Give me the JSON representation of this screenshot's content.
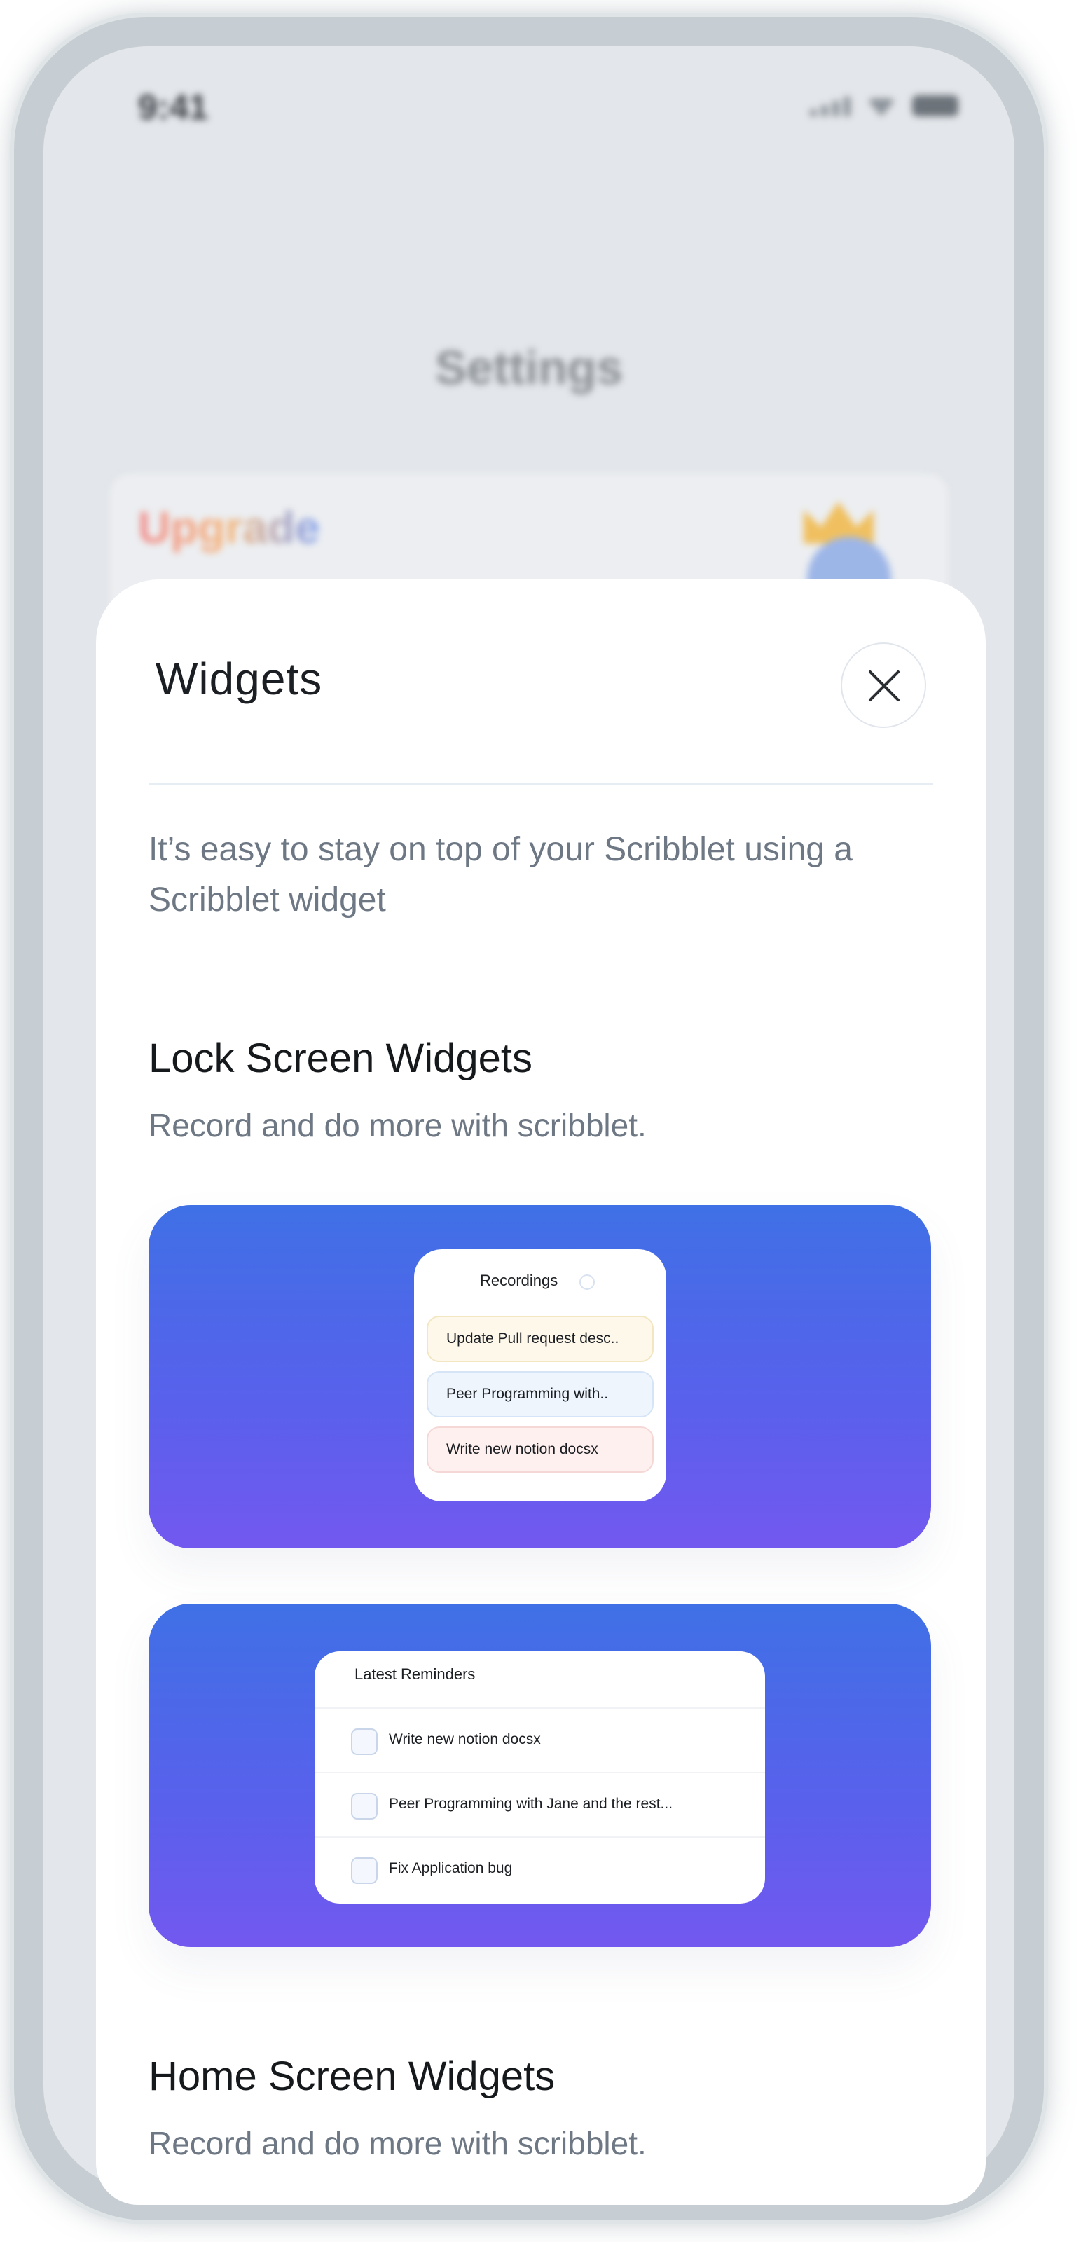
{
  "status_bar": {
    "time": "9:41"
  },
  "background": {
    "title": "Settings",
    "upgrade_label": "Upgrade"
  },
  "sheet": {
    "title": "Widgets",
    "intro": "It’s easy to stay on top of your Scribblet using a Scribblet widget",
    "sections": [
      {
        "title": "Lock Screen Widgets",
        "subtitle": "Record and do more with scribblet."
      },
      {
        "title": "Home Screen Widgets",
        "subtitle": "Record and do more with scribblet."
      }
    ]
  },
  "recordings_widget": {
    "title": "Recordings",
    "items": [
      {
        "label": "Update Pull request desc..",
        "bg": "#fdf8ea",
        "border": "#f3e6c2"
      },
      {
        "label": "Peer Programming with..",
        "bg": "#eef5fd",
        "border": "#d5e4f6"
      },
      {
        "label": "Write new notion docsx",
        "bg": "#fdf0ef",
        "border": "#f5d8d5"
      }
    ]
  },
  "reminders_widget": {
    "title": "Latest Reminders",
    "items": [
      {
        "label": "Write new notion docsx"
      },
      {
        "label": "Peer Programming with Jane and the rest..."
      },
      {
        "label": "Fix Application bug"
      }
    ]
  },
  "colors": {
    "banner_top": "#3f70e6",
    "banner_bottom": "#7358ef",
    "text_muted": "#6e7884"
  }
}
